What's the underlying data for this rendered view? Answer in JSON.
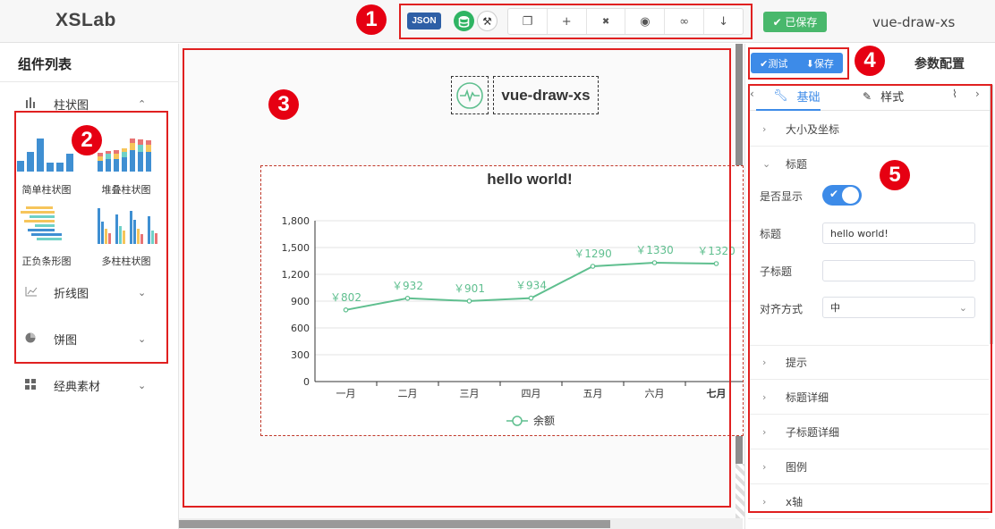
{
  "app": {
    "logo": "XSLab",
    "title": "vue-draw-xs"
  },
  "toolbar": {
    "json_label": "JSON",
    "buttons": [
      {
        "icon": "copy-icon",
        "glyph": "❐"
      },
      {
        "icon": "plus-icon",
        "glyph": "+"
      },
      {
        "icon": "trash-icon",
        "glyph": "✖"
      },
      {
        "icon": "eye-icon",
        "glyph": "◉"
      },
      {
        "icon": "link-icon",
        "glyph": "∞"
      },
      {
        "icon": "arrow-down-icon",
        "glyph": "↓"
      }
    ],
    "saved_label": "✔ 已保存",
    "saved_color": "#49b86c"
  },
  "annotations": [
    "1",
    "2",
    "3",
    "4",
    "5"
  ],
  "left": {
    "title": "组件列表",
    "categories": {
      "bar": "柱状图",
      "line": "折线图",
      "pie": "饼图",
      "classic": "经典素材"
    },
    "components": [
      "简单柱状图",
      "堆叠柱状图",
      "正负条形图",
      "多柱柱状图"
    ]
  },
  "canvas": {
    "widget_title": "vue-draw-xs"
  },
  "right": {
    "test_label": "✔测试",
    "save_label": "⬇保存",
    "title": "参数配置",
    "tabs": {
      "basic": "基础",
      "style": "样式"
    },
    "sections": {
      "size": "大小及坐标",
      "title": "标题",
      "tooltip": "提示",
      "title_detail": "标题详细",
      "subtitle_detail": "子标题详细",
      "legend": "图例",
      "xaxis": "x轴"
    },
    "form": {
      "show_label": "是否显示",
      "title_label": "标题",
      "title_value": "hello world!",
      "subtitle_label": "子标题",
      "subtitle_value": "",
      "align_label": "对齐方式",
      "align_value": "中"
    },
    "accent": "#3d8be8"
  },
  "chart_data": {
    "type": "line",
    "title": "hello world!",
    "categories": [
      "一月",
      "二月",
      "三月",
      "四月",
      "五月",
      "六月",
      "七月"
    ],
    "series": [
      {
        "name": "余额",
        "values": [
          802,
          932,
          901,
          934,
          1290,
          1330,
          1320
        ],
        "color": "#5fbf8f"
      }
    ],
    "data_labels": [
      "￥802",
      "￥932",
      "￥901",
      "￥934",
      "￥1290",
      "￥1330",
      "￥1320"
    ],
    "y_ticks": [
      "0",
      "300",
      "600",
      "900",
      "1,200",
      "1,500",
      "1,800"
    ],
    "ylim": [
      0,
      1800
    ],
    "grid": true,
    "legend": "bottom"
  }
}
